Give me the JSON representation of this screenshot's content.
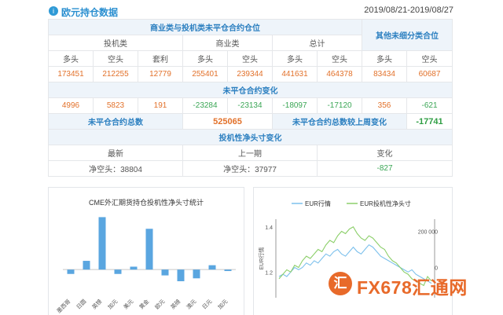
{
  "header": {
    "icon": "info-circle-icon",
    "title": "欧元持仓数据",
    "date_range": "2019/08/21-2019/08/27"
  },
  "table": {
    "title_left": "商业类与投机类未平仓合约仓位",
    "title_right": "其他未细分类合位",
    "groups": [
      "投机类",
      "商业类",
      "总计"
    ],
    "col_labels": [
      "多头",
      "空头",
      "套利",
      "多头",
      "空头",
      "多头",
      "空头",
      "多头",
      "空头"
    ],
    "positions": [
      "173451",
      "212255",
      "12779",
      "255401",
      "239344",
      "441631",
      "464378",
      "83434",
      "60687"
    ],
    "change_title": "未平仓合约变化",
    "changes": [
      "4996",
      "5823",
      "191",
      "-23284",
      "-23134",
      "-18097",
      "-17120",
      "356",
      "-621"
    ],
    "total_label": "未平仓合约总数",
    "total_value": "525065",
    "total_change_label": "未平仓合约总数较上周变化",
    "total_change_value": "-17741",
    "net_title": "投机性净头寸变化",
    "net_cols": [
      "最新",
      "上一期",
      "变化"
    ],
    "net_values": [
      "净空头：38804",
      "净空头：37977",
      "-827"
    ]
  },
  "colors": {
    "accent_blue": "#2b8fd0",
    "bar_blue": "#5aa6e0",
    "line_green": "#8ccf6a",
    "line_blue": "#7cc0ec",
    "orange": "#e2712a"
  },
  "chart_data": [
    {
      "type": "bar",
      "title": "CME外汇期货持仓投机性净头寸统计",
      "categories": [
        "墨西哥",
        "日圆",
        "英镑",
        "加元",
        "美元",
        "黄金",
        "欧元",
        "英磅",
        "澳元",
        "日元",
        "加元"
      ],
      "values": [
        -0.3,
        0.6,
        3.6,
        -0.3,
        0.2,
        2.8,
        -0.4,
        -0.8,
        -0.6,
        0.3,
        -0.1
      ],
      "ylim": [
        -1.5,
        4.0
      ],
      "grid": false
    },
    {
      "type": "line",
      "legend": [
        "EUR行情",
        "EUR投机性净头寸"
      ],
      "legend_position": "top",
      "ylabel": "EUR行情",
      "y_left_ticks": [
        "1.4",
        "1.2"
      ],
      "y_right_ticks": [
        "200 000",
        "0"
      ],
      "series": [
        {
          "name": "EUR行情",
          "values": [
            1.18,
            1.19,
            1.18,
            1.2,
            1.22,
            1.21,
            1.22,
            1.24,
            1.23,
            1.25,
            1.24,
            1.26,
            1.28,
            1.27,
            1.29,
            1.3,
            1.28,
            1.27,
            1.29,
            1.31,
            1.29,
            1.28,
            1.3,
            1.32,
            1.31,
            1.29,
            1.27,
            1.26,
            1.25,
            1.24,
            1.23,
            1.22,
            1.21,
            1.2,
            1.21,
            1.19,
            1.18,
            1.17,
            1.16,
            1.15
          ]
        },
        {
          "name": "EUR投机性净头寸",
          "values": [
            1.17,
            1.19,
            1.21,
            1.2,
            1.23,
            1.22,
            1.25,
            1.27,
            1.26,
            1.28,
            1.3,
            1.29,
            1.32,
            1.34,
            1.33,
            1.36,
            1.38,
            1.37,
            1.39,
            1.4,
            1.37,
            1.35,
            1.34,
            1.36,
            1.35,
            1.33,
            1.31,
            1.3,
            1.27,
            1.25,
            1.24,
            1.22,
            1.2,
            1.19,
            1.17,
            1.16,
            1.15,
            1.14,
            1.18,
            1.16
          ]
        }
      ]
    }
  ],
  "watermark": {
    "icon": "fx678-logo-icon",
    "glyph": "汇",
    "text": "FX678",
    "text2": "汇通网"
  }
}
